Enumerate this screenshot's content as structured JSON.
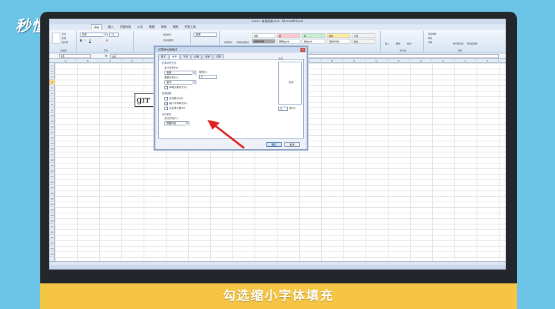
{
  "watermark": "秒懂视频",
  "window": {
    "title": "Excel - 新建表格.xlsx - Microsoft Excel"
  },
  "ribbon": {
    "tabs": [
      "开始",
      "插入",
      "页面布局",
      "公式",
      "数据",
      "审阅",
      "视图",
      "开发工具"
    ],
    "active_tab": "开始",
    "clipboard": {
      "cut": "剪切",
      "copy": "复制",
      "format_painter": "格式刷",
      "group": "剪贴板"
    },
    "font": {
      "name": "宋体",
      "size": "11",
      "group": "字体"
    },
    "alignment": {
      "wrap": "自动换行",
      "merge": "合并后居中",
      "group": "对齐方式"
    },
    "number": {
      "format": "常规",
      "group": "数字"
    },
    "styles": {
      "cells": [
        {
          "label": "常规",
          "bg": "#ffffff"
        },
        {
          "label": "差",
          "bg": "#ffc7ce"
        },
        {
          "label": "好",
          "bg": "#c6efce"
        },
        {
          "label": "适中",
          "bg": "#ffeb9c"
        },
        {
          "label": "计算",
          "bg": "#f2f2f2"
        },
        {
          "label": "检查单元格",
          "bg": "#a5a5a5"
        },
        {
          "label": "解释性文本",
          "bg": "#ffffff"
        },
        {
          "label": "警告文本",
          "bg": "#ffffff"
        },
        {
          "label": "链接单元格",
          "bg": "#ffffff"
        },
        {
          "label": "输出",
          "bg": "#f2f2f2"
        }
      ],
      "cond_format": "条件格式",
      "table_format": "套用表格格式",
      "group": "样式"
    },
    "cells": {
      "insert": "插入",
      "delete": "删除",
      "format": "格式",
      "group": "单元格"
    },
    "editing": {
      "autosum": "自动求和",
      "fill": "填充",
      "clear": "清除",
      "sort": "排序和筛选",
      "find": "查找和选择",
      "group": "编辑"
    }
  },
  "formula_bar": {
    "name_box": "F4",
    "fx": "fx",
    "value": "grr"
  },
  "columns": [
    "A",
    "B",
    "C",
    "D",
    "E",
    "F",
    "G",
    "H",
    "I",
    "J",
    "K",
    "L",
    "M",
    "N",
    "O",
    "P",
    "Q",
    "R",
    "S",
    "T"
  ],
  "selected_column": "F",
  "cell_value": "grr",
  "dialog": {
    "title": "设置单元格格式",
    "tabs": [
      "数字",
      "对齐",
      "字体",
      "边框",
      "填充",
      "保护"
    ],
    "active_tab": "对齐",
    "text_alignment": "文本对齐方式",
    "horizontal_label": "水平对齐(H):",
    "horizontal_value": "常规",
    "indent_label": "缩进(I):",
    "indent_value": "0",
    "vertical_label": "垂直对齐(V):",
    "vertical_value": "居中",
    "justify_distributed": "两端分散对齐(E)",
    "text_control": "文本控制",
    "wrap_text": "自动换行(W)",
    "shrink_to_fit": "缩小字体填充(K)",
    "merge_cells": "合并单元格(M)",
    "rtl_section": "从右到左",
    "text_direction_label": "文字方向(T):",
    "text_direction_value": "根据内容",
    "orientation": "方向",
    "orientation_text": "文本",
    "degrees_value": "0",
    "degrees_label": "度(D)",
    "ok": "确定",
    "cancel": "取消"
  },
  "caption": "勾选缩小字体填充"
}
